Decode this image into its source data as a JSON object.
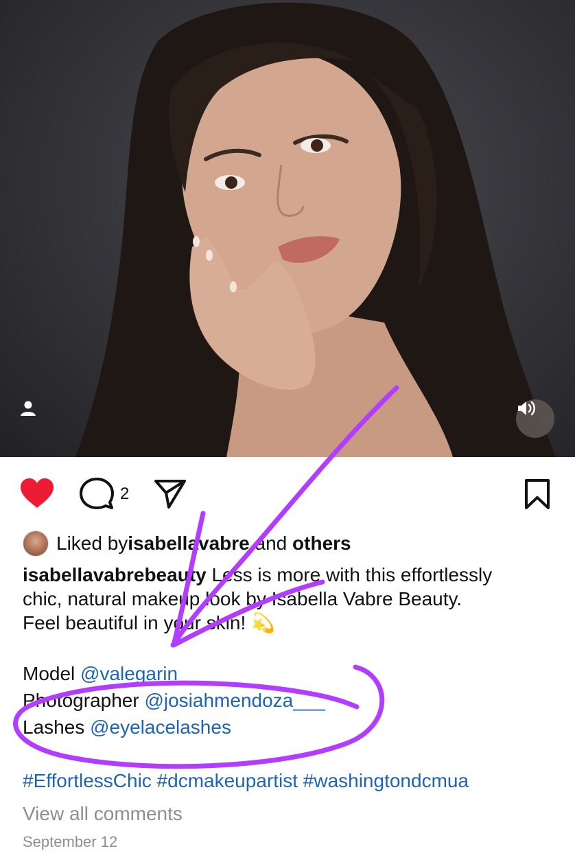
{
  "post": {
    "comment_count": "2",
    "liked_by": {
      "prefix": "Liked by ",
      "user": "isabellavabre",
      "and": " and ",
      "others": "others"
    },
    "caption": {
      "username": "isabellavabrebeauty",
      "line1_rest": " Less is more with this effortlessly",
      "line2": "chic, natural makeup look by Isabella Vabre Beauty.",
      "line3": "Feel beautiful in your skin! 💫"
    },
    "credits": [
      {
        "label": "Model ",
        "mention": "@valegarin_"
      },
      {
        "label": "Photographer ",
        "mention": "@josiahmendoza___"
      },
      {
        "label": "Lashes ",
        "mention": "@eyelacelashes"
      }
    ],
    "hashtags": "#EffortlessChic #dcmakeupartist #washingtondcmua",
    "view_comments": "View all comments",
    "date": "September 12"
  },
  "icons": {
    "user_tag": "person-icon",
    "audio": "speaker-icon",
    "like": "heart-icon",
    "comment": "comment-bubble-icon",
    "share": "paper-plane-icon",
    "save": "bookmark-icon"
  },
  "colors": {
    "like_red": "#ed1c34",
    "mention_blue": "#1f63b3",
    "annotation_purple": "#b23cff",
    "muted_gray": "#8e8e8e"
  }
}
